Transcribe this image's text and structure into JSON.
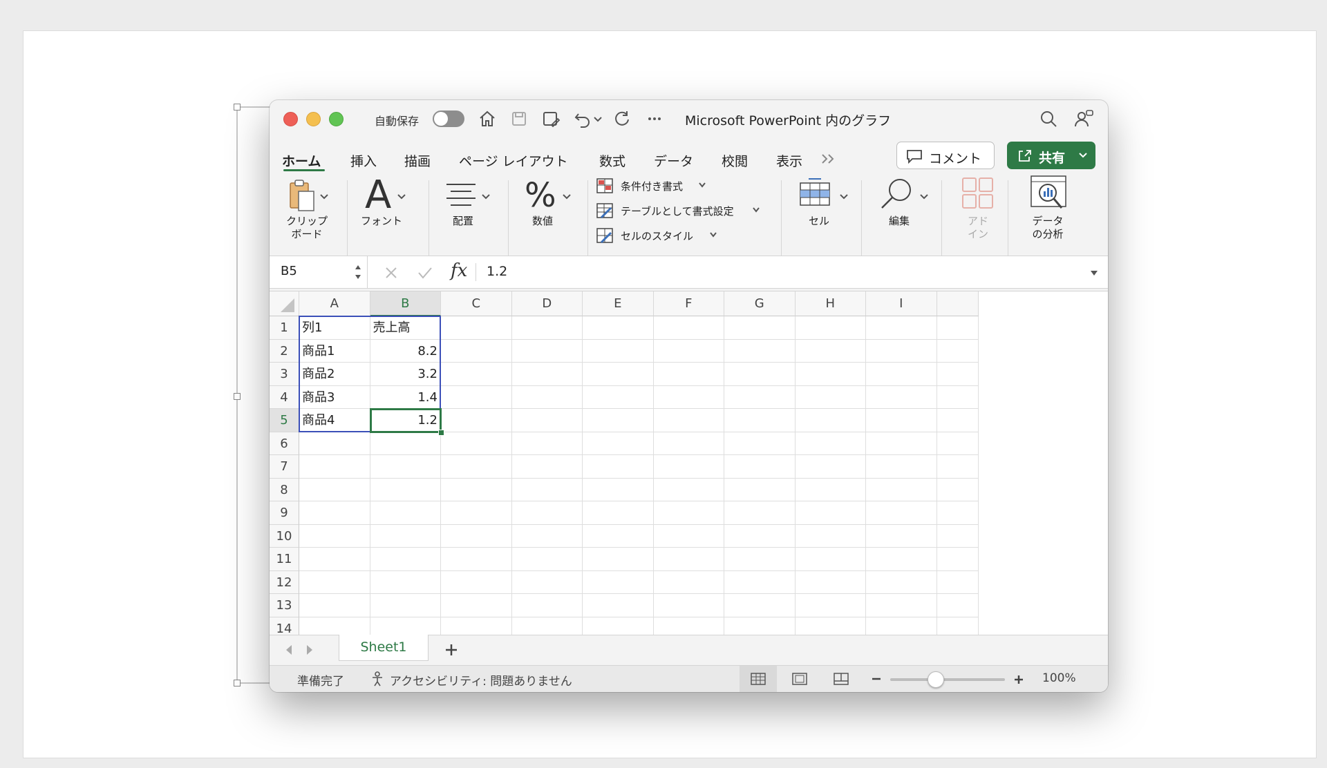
{
  "window": {
    "title": "Microsoft PowerPoint 内のグラフ",
    "autosave_label": "自動保存"
  },
  "tabs": [
    {
      "label": "ホーム",
      "active": true
    },
    {
      "label": "挿入"
    },
    {
      "label": "描画"
    },
    {
      "label": "ページ レイアウト"
    },
    {
      "label": "数式"
    },
    {
      "label": "データ"
    },
    {
      "label": "校閲"
    },
    {
      "label": "表示"
    }
  ],
  "actions": {
    "comment_label": "コメント",
    "share_label": "共有"
  },
  "ribbon": {
    "clipboard": "クリップ\nボード",
    "font": "フォント",
    "align": "配置",
    "number": "数値",
    "conditional_format": "条件付き書式",
    "format_as_table": "テーブルとして書式設定",
    "cell_styles": "セルのスタイル",
    "cells": "セル",
    "edit": "編集",
    "addins": "アド\nイン",
    "analyze": "データ\nの分析"
  },
  "formula_bar": {
    "name_box": "B5",
    "value": "1.2"
  },
  "grid": {
    "columns": [
      "A",
      "B",
      "C",
      "D",
      "E",
      "F",
      "G",
      "H",
      "I"
    ],
    "rows": [
      "1",
      "2",
      "3",
      "4",
      "5",
      "6",
      "7",
      "8",
      "9",
      "10",
      "11",
      "12",
      "13",
      "14"
    ],
    "selected_column": "B",
    "selected_row": "5",
    "cells": {
      "A1": "列1",
      "B1": "売上高",
      "A2": "商品1",
      "B2": "8.2",
      "A3": "商品2",
      "B3": "3.2",
      "A4": "商品3",
      "B4": "1.4",
      "A5": "商品4",
      "B5": "1.2"
    }
  },
  "sheets": [
    {
      "name": "Sheet1",
      "active": true
    }
  ],
  "status": {
    "ready": "準備完了",
    "accessibility": "アクセシビリティ: 問題ありません",
    "zoom": "100%",
    "zoom_level": 1.0
  },
  "colors": {
    "accent_green": "#2e7a46",
    "selection_blue": "#3b4fb8"
  }
}
